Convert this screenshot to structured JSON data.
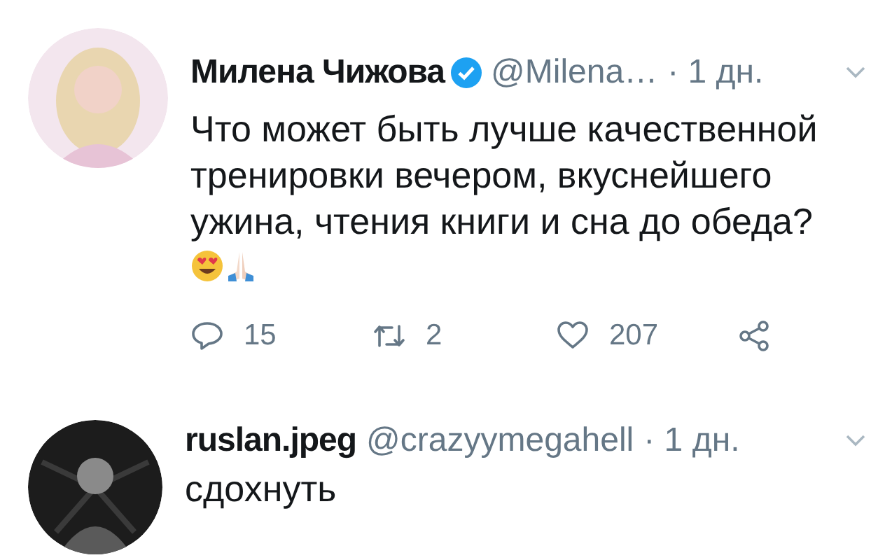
{
  "tweets": [
    {
      "display_name": "Милена Чижова",
      "verified": true,
      "handle": "@Milena…",
      "time": "· 1 дн.",
      "avatar": {
        "kind": "light"
      },
      "text": "Что может быть лучше качественной\nтренировки вечером, вкуснейшего\nужина, чтения книги и сна до обеда?",
      "reaction_icons": [
        {
          "kind": "heart-eyes-face"
        },
        {
          "kind": "folded-hands"
        }
      ],
      "actions": [
        {
          "kind": "reply",
          "count": "15"
        },
        {
          "kind": "retweet",
          "count": "2"
        },
        {
          "kind": "like",
          "count": "207"
        },
        {
          "kind": "share"
        }
      ]
    },
    {
      "display_name": "ruslan.jpeg",
      "verified": false,
      "handle": "@crazyymegahell",
      "time": "· 1 дн.",
      "avatar": {
        "kind": "dark"
      },
      "text": "сдохнуть"
    }
  ]
}
